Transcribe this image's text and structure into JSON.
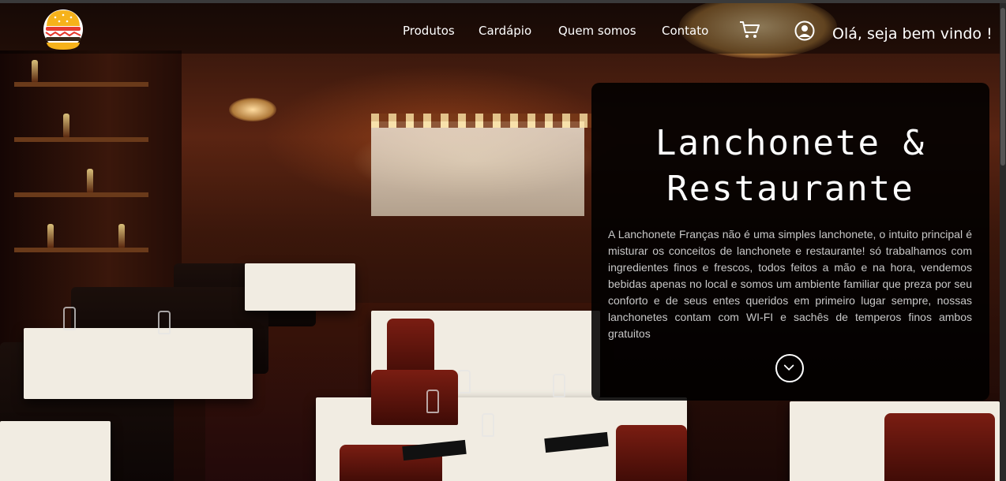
{
  "header": {
    "nav": [
      "Produtos",
      "Cardápio",
      "Quem somos",
      "Contato"
    ],
    "greeting": "Olá, seja bem vindo !",
    "icons": {
      "logo": "burger-logo",
      "cart": "cart-icon",
      "user": "user-circle-icon"
    }
  },
  "hero_card": {
    "title_line1": "Lanchonete &",
    "title_line2": "Restaurante",
    "description": "A Lanchonete Franças não é uma simples lanchonete, o intuito principal é misturar os conceitos de lanchonete e restaurante! só trabalhamos com ingredientes finos e frescos, todos feitos a mão e na hora, vendemos bebidas apenas no local e somos um ambiente familiar que preza por seu conforto e de seus entes queridos em primeiro lugar sempre, nossas lanchonetes contam com WI-FI e sachês de temperos finos ambos gratuitos",
    "scroll_icon": "chevron-down-circle-icon"
  },
  "colors": {
    "card_bg": "#000000",
    "text": "#ffffff",
    "logo_bun": "#f6b21b",
    "logo_patty": "#e63a2e"
  }
}
